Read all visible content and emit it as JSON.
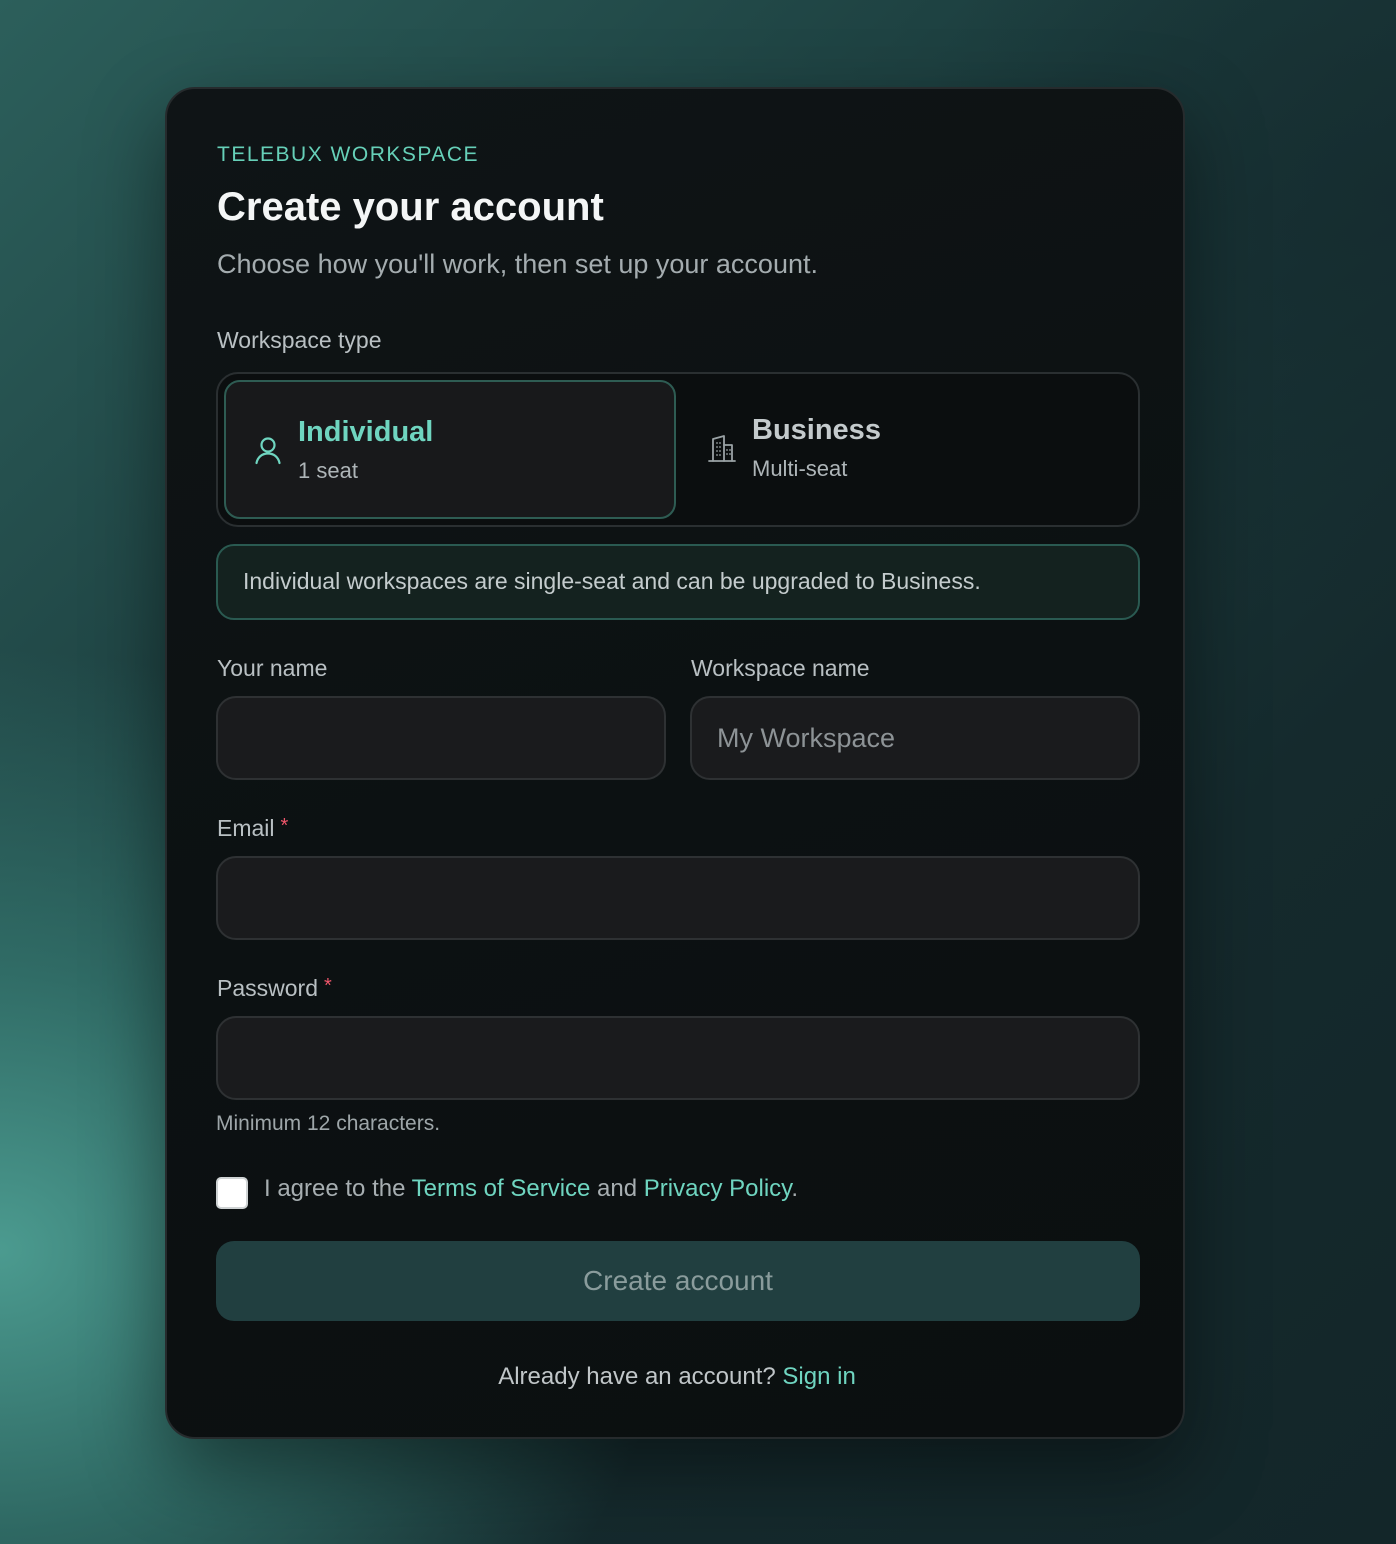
{
  "brand": {
    "eyebrow": "TELEBUX WORKSPACE"
  },
  "header": {
    "title": "Create your account",
    "subtitle": "Choose how you'll work, then set up your account."
  },
  "workspace_type": {
    "label": "Workspace type",
    "options": [
      {
        "title": "Individual",
        "subtitle": "1 seat",
        "icon": "user-icon",
        "selected": true
      },
      {
        "title": "Business",
        "subtitle": "Multi-seat",
        "icon": "building-icon",
        "selected": false
      }
    ],
    "notice": "Individual workspaces are single-seat and can be upgraded to Business."
  },
  "fields": {
    "your_name": {
      "label": "Your name",
      "value": "",
      "placeholder": ""
    },
    "workspace_name": {
      "label": "Workspace name",
      "value": "",
      "placeholder": "My Workspace"
    },
    "email": {
      "label": "Email",
      "required_mark": "*",
      "value": "",
      "placeholder": ""
    },
    "password": {
      "label": "Password",
      "required_mark": "*",
      "value": "",
      "placeholder": "",
      "hint": "Minimum 12 characters."
    }
  },
  "terms": {
    "checked": false,
    "prefix": "I agree to the ",
    "tos_link": "Terms of Service",
    "middle": " and ",
    "privacy_link": "Privacy Policy",
    "suffix": "."
  },
  "submit": {
    "label": "Create account",
    "disabled": true
  },
  "footer": {
    "text": "Already have an account?",
    "link": "Sign in"
  },
  "colors": {
    "accent": "#6fd5c0",
    "required": "#f0566a",
    "card_bg": "#0c1112",
    "button_disabled_bg": "#213f40"
  }
}
